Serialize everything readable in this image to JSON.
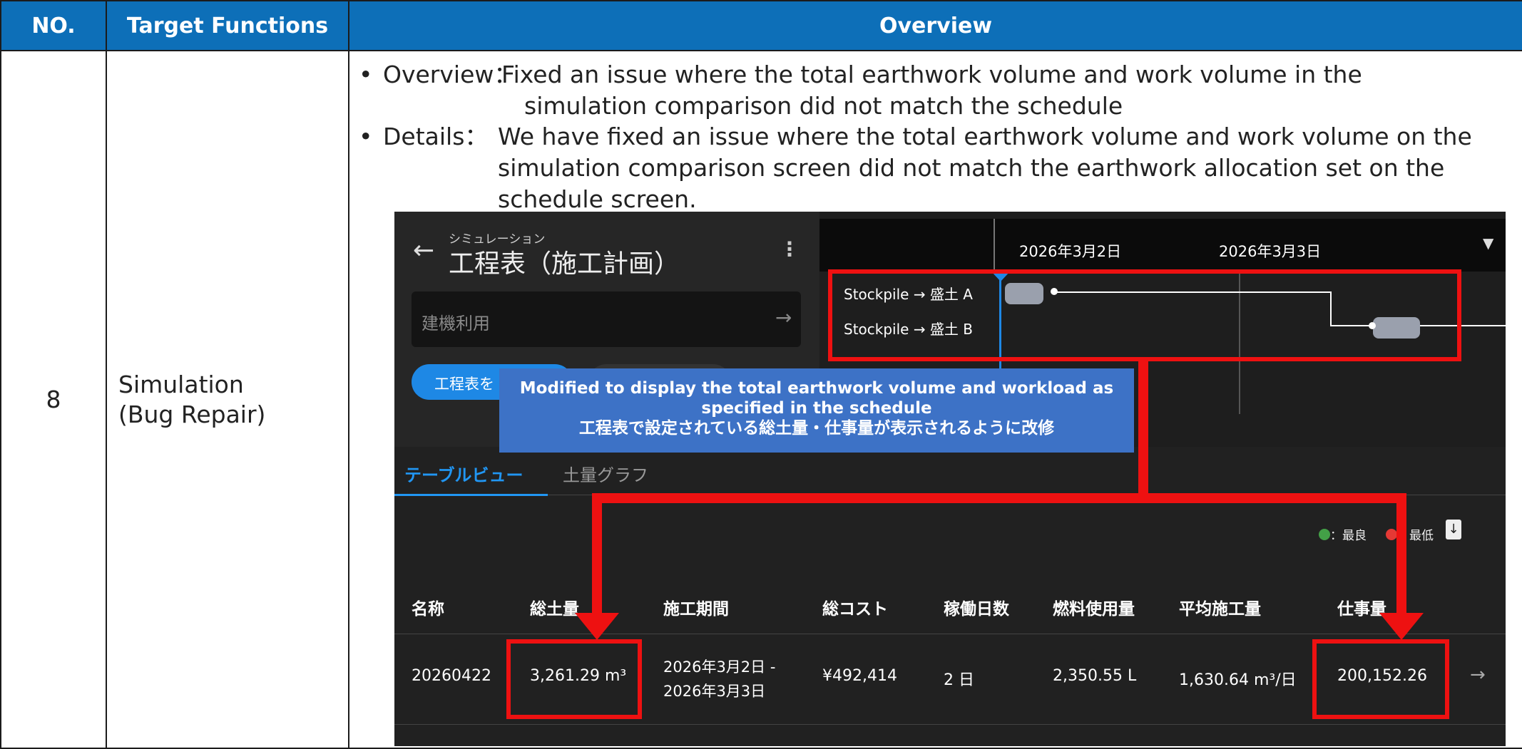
{
  "table": {
    "headers": [
      "NO.",
      "Target Functions",
      "Overview"
    ],
    "row": {
      "no": "8",
      "function_line1": "Simulation",
      "function_line2": "(Bug Repair)",
      "overview_label": "Overview：",
      "overview_line1": "Fixed an issue where the total earthwork volume and work volume in the",
      "overview_line2": "simulation comparison did not match the schedule",
      "details_label": "Details：",
      "details_line1": "We have fixed an issue where the total earthwork volume and work volume on the",
      "details_line2": "simulation comparison screen did not match the earthwork allocation set on the",
      "details_line3": "schedule screen."
    }
  },
  "screenshot": {
    "header_small": "シミュレーション",
    "title": "工程表（施工計画）",
    "search_placeholder": "建機利用",
    "chip_label": "工程表を",
    "gantt": {
      "dates": [
        "2026年3月2日",
        "2026年3月3日"
      ],
      "rows": [
        "Stockpile → 盛土 A",
        "Stockpile → 盛土 B"
      ]
    },
    "callout_en": "Modified to display the total earthwork volume and workload as specified in the schedule",
    "callout_jp": "工程表で設定されている総土量・仕事量が表示されるように改修",
    "tabs": [
      "テーブルビュー",
      "土量グラフ"
    ],
    "legend": {
      "best": "：最良",
      "worst": "：最低"
    },
    "columns": [
      "名称",
      "総土量",
      "施工期間",
      "総コスト",
      "稼働日数",
      "燃料使用量",
      "平均施工量",
      "仕事量"
    ],
    "row": {
      "name": "20260422",
      "volume": "3,261.29 m³",
      "period_line1": "2026年3月2日 -",
      "period_line2": "2026年3月3日",
      "cost": "¥492,414",
      "days": "2 日",
      "fuel": "2,350.55 L",
      "avg": "1,630.64 m³/日",
      "work": "200,152.26"
    },
    "colors": {
      "accent_blue": "#1e88e5",
      "highlight_red": "#ee1111",
      "callout_bg": "#3d72c6",
      "best_green": "#43a047",
      "worst_red": "#e53935"
    }
  }
}
